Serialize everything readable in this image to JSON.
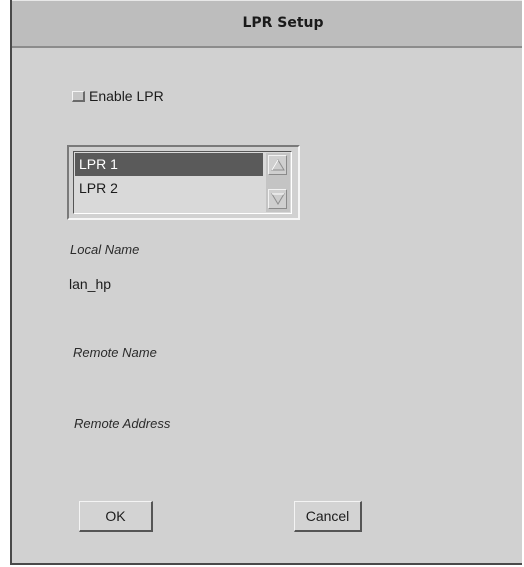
{
  "dialog": {
    "title": "LPR Setup",
    "enable_checkbox": {
      "label": "Enable LPR",
      "checked": false
    },
    "lpr_list": {
      "items": [
        {
          "label": "LPR 1",
          "selected": true
        },
        {
          "label": "LPR 2",
          "selected": false
        }
      ]
    },
    "local_name": {
      "label": "Local Name",
      "value": "lan_hp"
    },
    "remote_name": {
      "label": "Remote Name",
      "value": ""
    },
    "remote_address": {
      "label": "Remote Address",
      "value": ""
    },
    "ok_label": "OK",
    "cancel_label": "Cancel"
  },
  "icons": {
    "scroll_up": "arrow-up-icon",
    "scroll_down": "arrow-down-icon"
  }
}
